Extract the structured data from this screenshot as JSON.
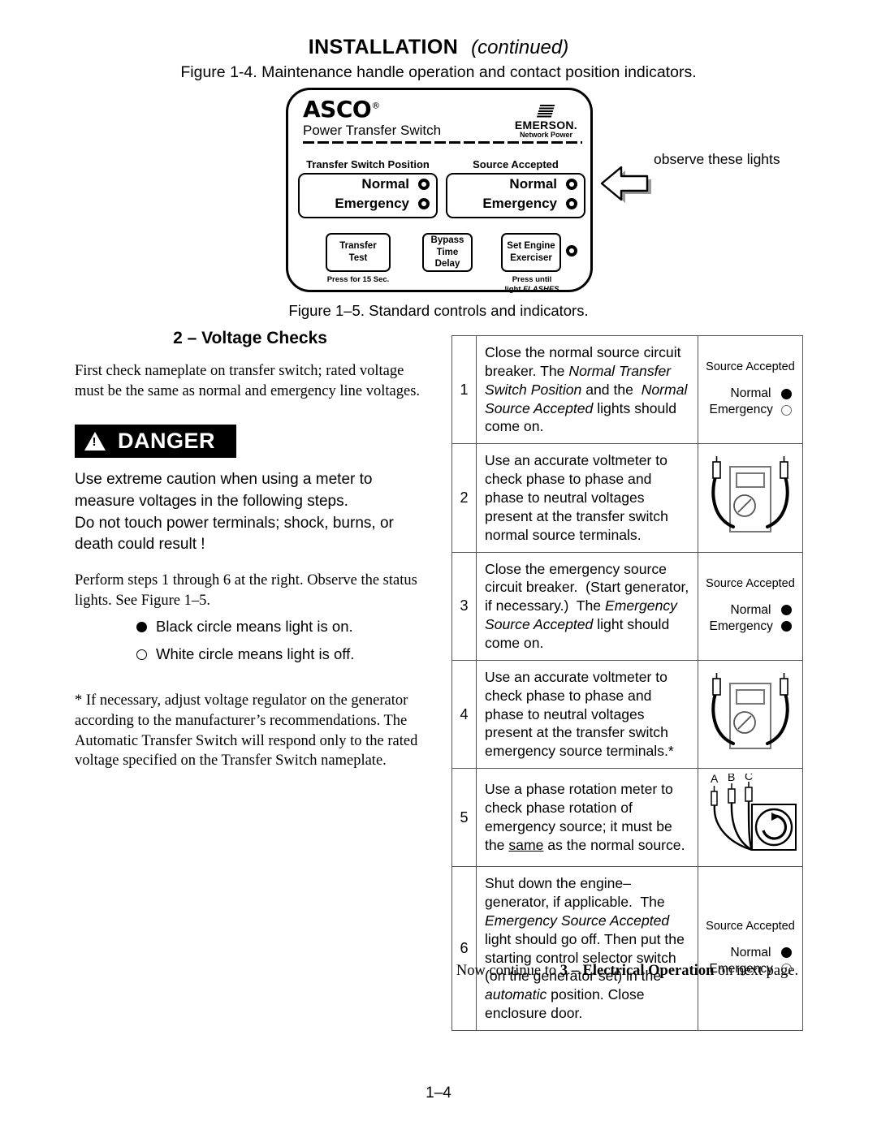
{
  "header": {
    "title": "INSTALLATION",
    "continued": "(continued)",
    "figure_1_4_caption": "Figure 1-4.  Maintenance handle operation and contact position indicators."
  },
  "panel": {
    "brand": "ASCO",
    "brand_registered": "®",
    "brand_sub": "Power Transfer Switch",
    "emerson_name": "EMERSON.",
    "emerson_tagline": "Network Power",
    "group_left_label": "Transfer Switch Position",
    "group_right_label": "Source Accepted",
    "row_normal": "Normal",
    "row_emergency": "Emergency",
    "button_transfer_test": "Transfer\nTest",
    "button_transfer_test_l1": "Transfer",
    "button_transfer_test_l2": "Test",
    "button_transfer_test_caption": "Press for 15 Sec.",
    "button_bypass_l1": "Bypass",
    "button_bypass_l2": "Time Delay",
    "button_exerciser_l1": "Set Engine",
    "button_exerciser_l2": "Exerciser",
    "button_exerciser_caption_l1": "Press until",
    "button_exerciser_caption_l2a": "light ",
    "button_exerciser_caption_l2b": "FLASHES"
  },
  "annotation": {
    "observe_lights": "observe these lights"
  },
  "figure_1_5_caption": "Figure 1–5.  Standard controls and indicators.",
  "left": {
    "section_title": "2 – Voltage Checks",
    "intro": "First check nameplate on transfer switch; rated voltage must be the same as normal and emergency line voltages.",
    "danger_word": "DANGER",
    "danger_body_1": "Use extreme caution when using a meter to measure voltages in the following steps.",
    "danger_body_2": "Do not touch power terminals; shock, burns, or death could result !",
    "perform_steps": "Perform steps 1 through 6 at the right.  Observe the status lights.  See Figure 1–5.",
    "legend_on": "Black circle means light is on.",
    "legend_off": "White circle means light is off.",
    "footnote": "* If necessary, adjust voltage regulator on the generator according to the manufacturer’s recommendations.  The Automatic Transfer Switch will respond only to the rated voltage specified on the Transfer Switch nameplate."
  },
  "steps": [
    {
      "num": "1",
      "illustration": "source-accepted-indicator",
      "indicator": {
        "title": "Source Accepted",
        "normal_label": "Normal",
        "normal_state": "on",
        "emergency_label": "Emergency",
        "emergency_state": "off"
      }
    },
    {
      "num": "2",
      "illustration": "voltmeter"
    },
    {
      "num": "3",
      "illustration": "source-accepted-indicator",
      "indicator": {
        "title": "Source Accepted",
        "normal_label": "Normal",
        "normal_state": "on",
        "emergency_label": "Emergency",
        "emergency_state": "on"
      }
    },
    {
      "num": "4",
      "illustration": "voltmeter"
    },
    {
      "num": "5",
      "illustration": "phase-rotation-meter",
      "probe_labels": [
        "A",
        "B",
        "C"
      ]
    },
    {
      "num": "6",
      "illustration": "source-accepted-indicator",
      "indicator": {
        "title": "Source Accepted",
        "normal_label": "Normal",
        "normal_state": "on",
        "emergency_label": "Emergency",
        "emergency_state": "off"
      }
    }
  ],
  "footer": {
    "continue_prefix": "Now continue to ",
    "continue_bold": "3 – Electrical Operation",
    "continue_suffix": " on next page.",
    "page_number": "1–4"
  }
}
